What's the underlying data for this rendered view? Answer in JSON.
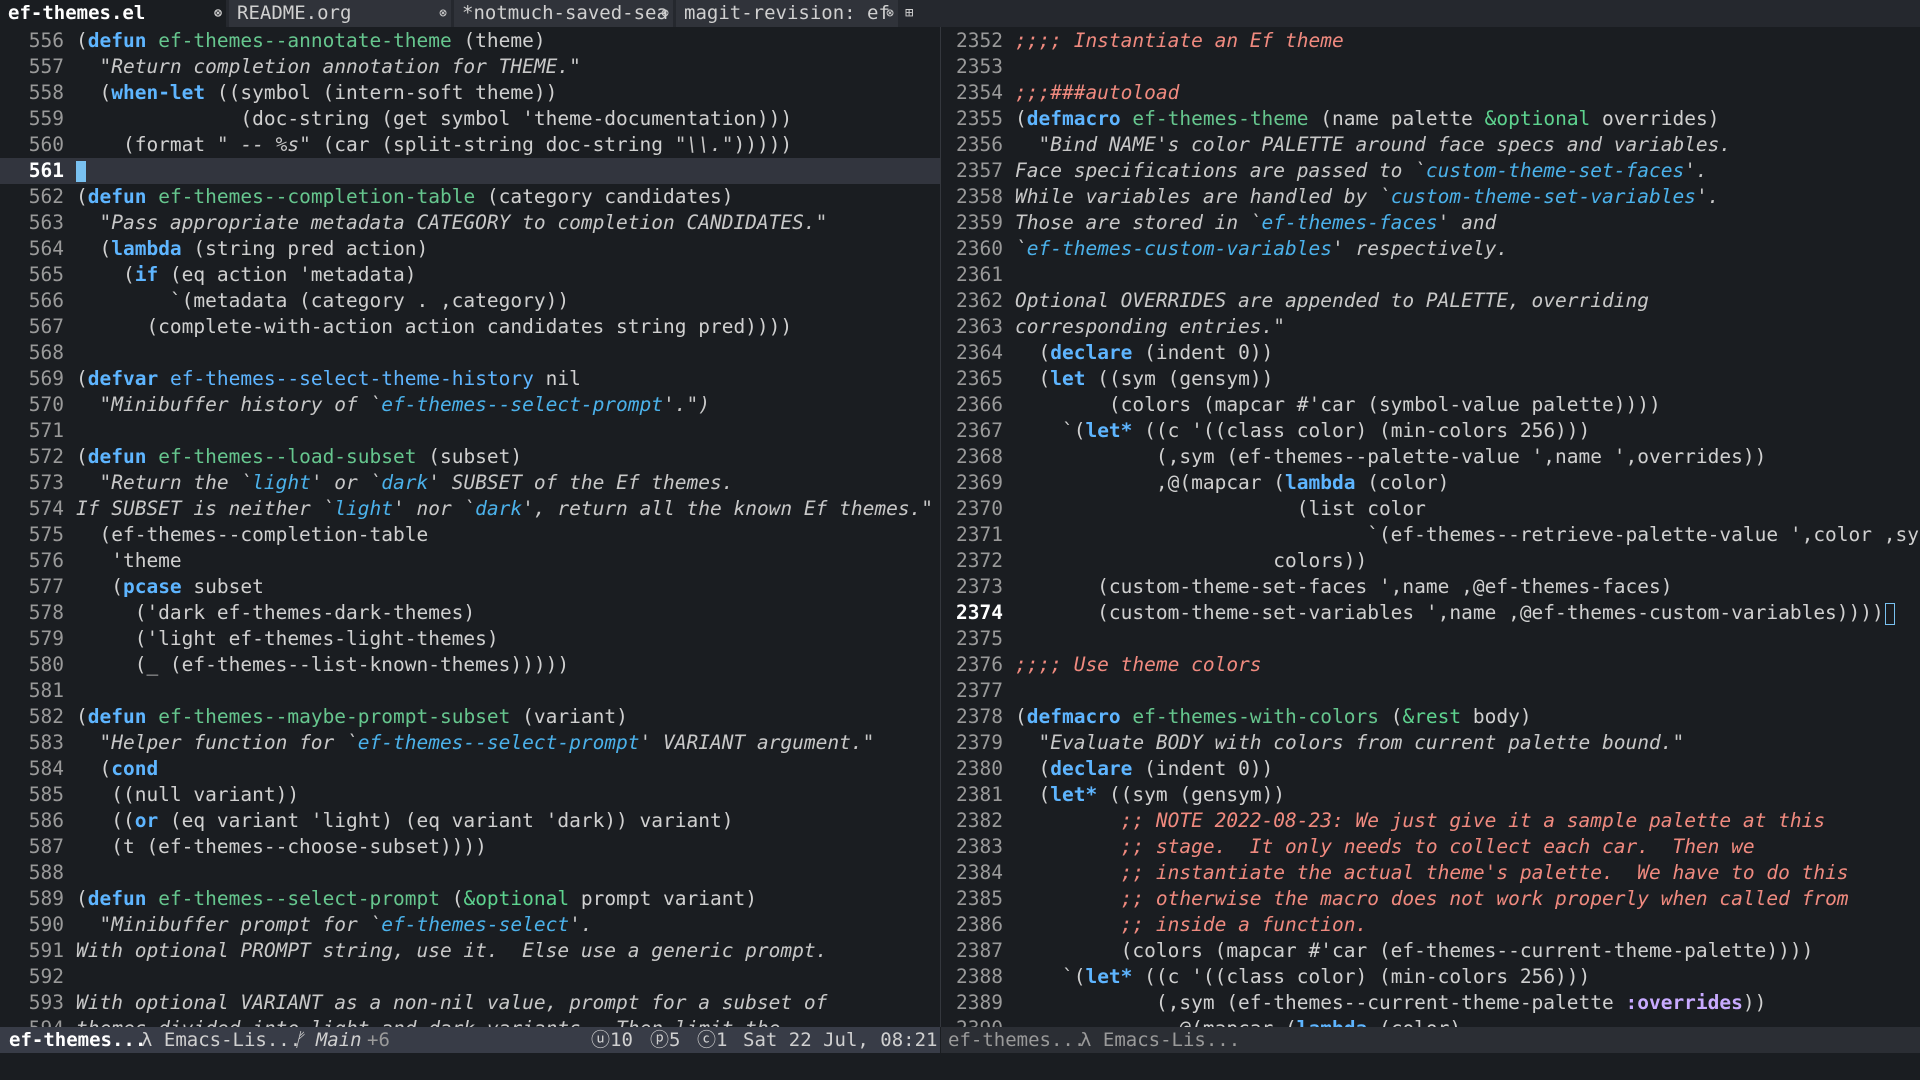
{
  "tabs": [
    {
      "label": "ef-themes.el",
      "active": true,
      "close": "⊗"
    },
    {
      "label": "README.org",
      "active": false,
      "close": "⊗"
    },
    {
      "label": "*notmuch-saved-sea",
      "active": false,
      "close": "⊗"
    },
    {
      "label": "magit-revision: ef",
      "active": false,
      "close": "⊗"
    }
  ],
  "tab_add_icon": "⊞",
  "left_pane": {
    "current_line": "561",
    "lines": [
      {
        "n": "556",
        "segs": [
          [
            "",
            "("
          ],
          [
            "kw",
            "defun"
          ],
          [
            "",
            " "
          ],
          [
            "fn",
            "ef-themes--annotate-theme"
          ],
          [
            "",
            " (theme)"
          ]
        ]
      },
      {
        "n": "557",
        "segs": [
          [
            "",
            "  "
          ],
          [
            "str",
            "\"Return completion annotation for THEME.\""
          ]
        ]
      },
      {
        "n": "558",
        "segs": [
          [
            "",
            "  ("
          ],
          [
            "kw",
            "when-let"
          ],
          [
            "",
            " ((symbol (intern-soft theme))"
          ]
        ]
      },
      {
        "n": "559",
        "segs": [
          [
            "",
            "              (doc-string (get symbol 'theme-documentation)))"
          ]
        ]
      },
      {
        "n": "560",
        "segs": [
          [
            "",
            "    (format "
          ],
          [
            "str",
            "\" -- %s\""
          ],
          [
            "",
            " (car (split-string doc-string "
          ],
          [
            "str",
            "\"\\\\.\""
          ],
          [
            "",
            ")))))"
          ]
        ]
      },
      {
        "n": "561",
        "segs": [],
        "current": true
      },
      {
        "n": "562",
        "segs": [
          [
            "",
            "("
          ],
          [
            "kw",
            "defun"
          ],
          [
            "",
            " "
          ],
          [
            "fn",
            "ef-themes--completion-table"
          ],
          [
            "",
            " (category candidates)"
          ]
        ]
      },
      {
        "n": "563",
        "segs": [
          [
            "",
            "  "
          ],
          [
            "str",
            "\"Pass appropriate metadata CATEGORY to completion CANDIDATES.\""
          ]
        ]
      },
      {
        "n": "564",
        "segs": [
          [
            "",
            "  ("
          ],
          [
            "kw",
            "lambda"
          ],
          [
            "",
            " (string pred action)"
          ]
        ]
      },
      {
        "n": "565",
        "segs": [
          [
            "",
            "    ("
          ],
          [
            "kw",
            "if"
          ],
          [
            "",
            " (eq action 'metadata)"
          ]
        ]
      },
      {
        "n": "566",
        "segs": [
          [
            "",
            "        `(metadata (category . ,category))"
          ]
        ]
      },
      {
        "n": "567",
        "segs": [
          [
            "",
            "      (complete-with-action action candidates string pred))))"
          ]
        ]
      },
      {
        "n": "568",
        "segs": []
      },
      {
        "n": "569",
        "segs": [
          [
            "",
            "("
          ],
          [
            "kw",
            "defvar"
          ],
          [
            "",
            " "
          ],
          [
            "vr",
            "ef-themes--select-theme-history"
          ],
          [
            "",
            " nil"
          ]
        ]
      },
      {
        "n": "570",
        "segs": [
          [
            "",
            "  "
          ],
          [
            "str",
            "\"Minibuffer history of `"
          ],
          [
            "link",
            "ef-themes--select-prompt"
          ],
          [
            "str",
            "'.\")"
          ]
        ]
      },
      {
        "n": "571",
        "segs": []
      },
      {
        "n": "572",
        "segs": [
          [
            "",
            "("
          ],
          [
            "kw",
            "defun"
          ],
          [
            "",
            " "
          ],
          [
            "fn",
            "ef-themes--load-subset"
          ],
          [
            "",
            " (subset)"
          ]
        ]
      },
      {
        "n": "573",
        "segs": [
          [
            "",
            "  "
          ],
          [
            "str",
            "\"Return the `"
          ],
          [
            "link",
            "light"
          ],
          [
            "str",
            "' or `"
          ],
          [
            "link",
            "dark"
          ],
          [
            "str",
            "' SUBSET of the Ef themes."
          ]
        ]
      },
      {
        "n": "574",
        "segs": [
          [
            "str",
            "If SUBSET is neither `"
          ],
          [
            "link",
            "light"
          ],
          [
            "str",
            "' nor `"
          ],
          [
            "link",
            "dark"
          ],
          [
            "str",
            "', return all the known Ef themes.\""
          ]
        ]
      },
      {
        "n": "575",
        "segs": [
          [
            "",
            "  (ef-themes--completion-table"
          ]
        ]
      },
      {
        "n": "576",
        "segs": [
          [
            "",
            "   'theme"
          ]
        ]
      },
      {
        "n": "577",
        "segs": [
          [
            "",
            "   ("
          ],
          [
            "kw",
            "pcase"
          ],
          [
            "",
            " subset"
          ]
        ]
      },
      {
        "n": "578",
        "segs": [
          [
            "",
            "     ('dark ef-themes-dark-themes)"
          ]
        ]
      },
      {
        "n": "579",
        "segs": [
          [
            "",
            "     ('light ef-themes-light-themes)"
          ]
        ]
      },
      {
        "n": "580",
        "segs": [
          [
            "",
            "     (_ (ef-themes--list-known-themes)))))"
          ]
        ]
      },
      {
        "n": "581",
        "segs": []
      },
      {
        "n": "582",
        "segs": [
          [
            "",
            "("
          ],
          [
            "kw",
            "defun"
          ],
          [
            "",
            " "
          ],
          [
            "fn",
            "ef-themes--maybe-prompt-subset"
          ],
          [
            "",
            " (variant)"
          ]
        ]
      },
      {
        "n": "583",
        "segs": [
          [
            "",
            "  "
          ],
          [
            "str",
            "\"Helper function for `"
          ],
          [
            "link",
            "ef-themes--select-prompt"
          ],
          [
            "str",
            "' VARIANT argument.\""
          ]
        ]
      },
      {
        "n": "584",
        "segs": [
          [
            "",
            "  ("
          ],
          [
            "kw",
            "cond"
          ]
        ]
      },
      {
        "n": "585",
        "segs": [
          [
            "",
            "   ((null variant))"
          ]
        ]
      },
      {
        "n": "586",
        "segs": [
          [
            "",
            "   (("
          ],
          [
            "kw",
            "or"
          ],
          [
            "",
            " (eq variant 'light) (eq variant 'dark)) variant)"
          ]
        ]
      },
      {
        "n": "587",
        "segs": [
          [
            "",
            "   (t (ef-themes--choose-subset))))"
          ]
        ]
      },
      {
        "n": "588",
        "segs": []
      },
      {
        "n": "589",
        "segs": [
          [
            "",
            "("
          ],
          [
            "kw",
            "defun"
          ],
          [
            "",
            " "
          ],
          [
            "fn",
            "ef-themes--select-prompt"
          ],
          [
            "",
            " ("
          ],
          [
            "opt",
            "&optional"
          ],
          [
            "",
            " prompt variant)"
          ]
        ]
      },
      {
        "n": "590",
        "segs": [
          [
            "",
            "  "
          ],
          [
            "str",
            "\"Minibuffer prompt for `"
          ],
          [
            "link",
            "ef-themes-select"
          ],
          [
            "str",
            "'."
          ]
        ]
      },
      {
        "n": "591",
        "segs": [
          [
            "str",
            "With optional PROMPT string, use it.  Else use a generic prompt."
          ]
        ]
      },
      {
        "n": "592",
        "segs": []
      },
      {
        "n": "593",
        "segs": [
          [
            "str",
            "With optional VARIANT as a non-nil value, prompt for a subset of"
          ]
        ]
      },
      {
        "n": "594",
        "segs": [
          [
            "str",
            "themes divided into light and dark variants.  Then limit the"
          ]
        ]
      }
    ]
  },
  "right_pane": {
    "current_line": "2374",
    "lines": [
      {
        "n": "2352",
        "segs": [
          [
            "cmt",
            ";;;; Instantiate an Ef theme"
          ]
        ]
      },
      {
        "n": "2353",
        "segs": []
      },
      {
        "n": "2354",
        "segs": [
          [
            "cmt",
            ";;;###autoload"
          ]
        ]
      },
      {
        "n": "2355",
        "segs": [
          [
            "",
            "("
          ],
          [
            "kw",
            "defmacro"
          ],
          [
            "",
            " "
          ],
          [
            "fn",
            "ef-themes-theme"
          ],
          [
            "",
            " (name palette "
          ],
          [
            "opt",
            "&optional"
          ],
          [
            "",
            " overrides)"
          ]
        ]
      },
      {
        "n": "2356",
        "segs": [
          [
            "",
            "  "
          ],
          [
            "str",
            "\"Bind NAME's color PALETTE around face specs and variables."
          ]
        ]
      },
      {
        "n": "2357",
        "segs": [
          [
            "str",
            "Face specifications are passed to `"
          ],
          [
            "link",
            "custom-theme-set-faces"
          ],
          [
            "str",
            "'."
          ]
        ]
      },
      {
        "n": "2358",
        "segs": [
          [
            "str",
            "While variables are handled by `"
          ],
          [
            "link",
            "custom-theme-set-variables"
          ],
          [
            "str",
            "'."
          ]
        ]
      },
      {
        "n": "2359",
        "segs": [
          [
            "str",
            "Those are stored in `"
          ],
          [
            "link",
            "ef-themes-faces"
          ],
          [
            "str",
            "' and"
          ]
        ]
      },
      {
        "n": "2360",
        "segs": [
          [
            "str",
            "`"
          ],
          [
            "link",
            "ef-themes-custom-variables"
          ],
          [
            "str",
            "' respectively."
          ]
        ]
      },
      {
        "n": "2361",
        "segs": []
      },
      {
        "n": "2362",
        "segs": [
          [
            "str",
            "Optional OVERRIDES are appended to PALETTE, overriding"
          ]
        ]
      },
      {
        "n": "2363",
        "segs": [
          [
            "str",
            "corresponding entries.\""
          ]
        ]
      },
      {
        "n": "2364",
        "segs": [
          [
            "",
            "  ("
          ],
          [
            "kw",
            "declare"
          ],
          [
            "",
            " (indent 0))"
          ]
        ]
      },
      {
        "n": "2365",
        "segs": [
          [
            "",
            "  ("
          ],
          [
            "kw",
            "let"
          ],
          [
            "",
            " ((sym (gensym))"
          ]
        ]
      },
      {
        "n": "2366",
        "segs": [
          [
            "",
            "        (colors (mapcar #'car (symbol-value palette))))"
          ]
        ]
      },
      {
        "n": "2367",
        "segs": [
          [
            "",
            "    `("
          ],
          [
            "kw",
            "let*"
          ],
          [
            "",
            " ((c '((class color) (min-colors 256)))"
          ]
        ]
      },
      {
        "n": "2368",
        "segs": [
          [
            "",
            "            (,sym (ef-themes--palette-value ',name ',overrides))"
          ]
        ]
      },
      {
        "n": "2369",
        "segs": [
          [
            "",
            "            ,@(mapcar ("
          ],
          [
            "kw",
            "lambda"
          ],
          [
            "",
            " (color)"
          ]
        ]
      },
      {
        "n": "2370",
        "segs": [
          [
            "",
            "                        (list color"
          ]
        ]
      },
      {
        "n": "2371",
        "segs": [
          [
            "",
            "                              `(ef-themes--retrieve-palette-value ',color ,sym)))"
          ]
        ]
      },
      {
        "n": "2372",
        "segs": [
          [
            "",
            "                      colors))"
          ]
        ]
      },
      {
        "n": "2373",
        "segs": [
          [
            "",
            "       (custom-theme-set-faces ',name ,@ef-themes-faces)"
          ]
        ]
      },
      {
        "n": "2374",
        "segs": [
          [
            "",
            "       (custom-theme-set-variables ',name ,@ef-themes-custom-variables))))"
          ]
        ],
        "cursor": true,
        "current": true
      },
      {
        "n": "2375",
        "segs": []
      },
      {
        "n": "2376",
        "segs": [
          [
            "cmt",
            ";;;; Use theme colors"
          ]
        ]
      },
      {
        "n": "2377",
        "segs": []
      },
      {
        "n": "2378",
        "segs": [
          [
            "",
            "("
          ],
          [
            "kw",
            "defmacro"
          ],
          [
            "",
            " "
          ],
          [
            "fn",
            "ef-themes-with-colors"
          ],
          [
            "",
            " ("
          ],
          [
            "opt",
            "&rest"
          ],
          [
            "",
            " body)"
          ]
        ]
      },
      {
        "n": "2379",
        "segs": [
          [
            "",
            "  "
          ],
          [
            "str",
            "\"Evaluate BODY with colors from current palette bound.\""
          ]
        ]
      },
      {
        "n": "2380",
        "segs": [
          [
            "",
            "  ("
          ],
          [
            "kw",
            "declare"
          ],
          [
            "",
            " (indent 0))"
          ]
        ]
      },
      {
        "n": "2381",
        "segs": [
          [
            "",
            "  ("
          ],
          [
            "kw",
            "let*"
          ],
          [
            "",
            " ((sym (gensym))"
          ]
        ]
      },
      {
        "n": "2382",
        "segs": [
          [
            "",
            "         "
          ],
          [
            "cmt",
            ";; NOTE 2022-08-23: We just give it a sample palette at this"
          ]
        ]
      },
      {
        "n": "2383",
        "segs": [
          [
            "",
            "         "
          ],
          [
            "cmt",
            ";; stage.  It only needs to collect each car.  Then we"
          ]
        ]
      },
      {
        "n": "2384",
        "segs": [
          [
            "",
            "         "
          ],
          [
            "cmt",
            ";; instantiate the actual theme's palette.  We have to do this"
          ]
        ]
      },
      {
        "n": "2385",
        "segs": [
          [
            "",
            "         "
          ],
          [
            "cmt",
            ";; otherwise the macro does not work properly when called from"
          ]
        ]
      },
      {
        "n": "2386",
        "segs": [
          [
            "",
            "         "
          ],
          [
            "cmt",
            ";; inside a function."
          ]
        ]
      },
      {
        "n": "2387",
        "segs": [
          [
            "",
            "         (colors (mapcar #'car (ef-themes--current-theme-palette))))"
          ]
        ]
      },
      {
        "n": "2388",
        "segs": [
          [
            "",
            "    `("
          ],
          [
            "kw",
            "let*"
          ],
          [
            "",
            " ((c '((class color) (min-colors 256)))"
          ]
        ]
      },
      {
        "n": "2389",
        "segs": [
          [
            "",
            "            (,sym (ef-themes--current-theme-palette "
          ],
          [
            "kws",
            ":overrides"
          ],
          [
            "",
            "))"
          ]
        ]
      },
      {
        "n": "2390",
        "segs": [
          [
            "",
            "             ,@(mapcar ("
          ],
          [
            "kw",
            "lambda"
          ],
          [
            "",
            " (color)"
          ]
        ]
      }
    ]
  },
  "modeline_left": {
    "buffer": "ef-themes...",
    "mode": "λ Emacs-Lis...",
    "branch": "ᚠ Main",
    "changes": "+6",
    "count_u": "ⓤ10",
    "count_p": "ⓟ5",
    "count_c": "ⓒ1",
    "datetime": "Sat 22 Jul, 08:21"
  },
  "modeline_right": {
    "buffer": "ef-themes...",
    "mode": "λ Emacs-Lis..."
  },
  "colors": {
    "background": "#1a1d21",
    "keyword": "#5eb5ff",
    "function_name": "#66c68e",
    "comment": "#f08a7f",
    "docstring": "#c8c8c8",
    "link": "#4bb1ea",
    "cursor": "#79c1f0",
    "modeline_active": "#383c47"
  }
}
